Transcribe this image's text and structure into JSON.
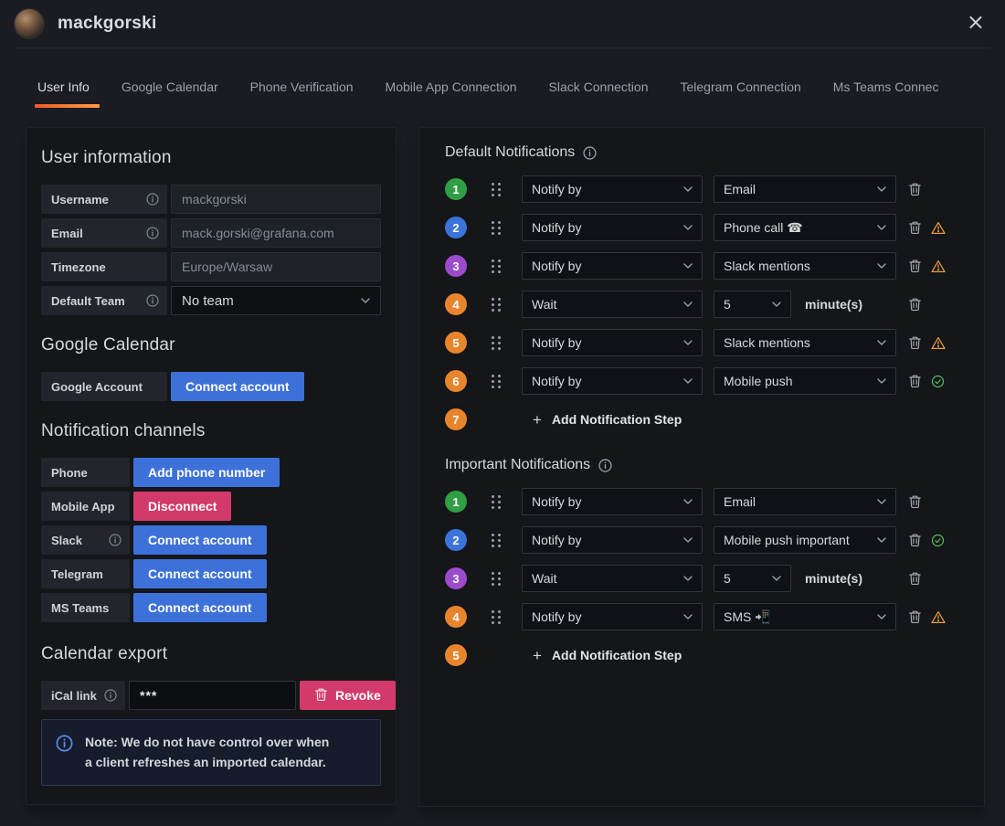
{
  "header": {
    "title": "mackgorski",
    "close_glyph": "×"
  },
  "tabs": [
    {
      "label": "User Info",
      "active": true
    },
    {
      "label": "Google Calendar",
      "active": false
    },
    {
      "label": "Phone Verification",
      "active": false
    },
    {
      "label": "Mobile App Connection",
      "active": false
    },
    {
      "label": "Slack Connection",
      "active": false
    },
    {
      "label": "Telegram Connection",
      "active": false
    },
    {
      "label": "Ms Teams Connec",
      "active": false
    }
  ],
  "user_info": {
    "heading": "User information",
    "fields": [
      {
        "label": "Username",
        "info": true,
        "value": "mackgorski",
        "control": "input"
      },
      {
        "label": "Email",
        "info": true,
        "value": "mack.gorski@grafana.com",
        "control": "input"
      },
      {
        "label": "Timezone",
        "info": false,
        "value": "Europe/Warsaw",
        "control": "input"
      },
      {
        "label": "Default Team",
        "info": true,
        "value": "No team",
        "control": "select"
      }
    ]
  },
  "google_calendar": {
    "heading": "Google Calendar",
    "label": "Google Account",
    "button_label": "Connect account"
  },
  "notification_channels": {
    "heading": "Notification channels",
    "rows": [
      {
        "label": "Phone",
        "info": false,
        "button_label": "Add phone number",
        "button_style": "primary"
      },
      {
        "label": "Mobile App",
        "info": false,
        "button_label": "Disconnect",
        "button_style": "danger"
      },
      {
        "label": "Slack",
        "info": true,
        "button_label": "Connect account",
        "button_style": "primary"
      },
      {
        "label": "Telegram",
        "info": false,
        "button_label": "Connect account",
        "button_style": "primary"
      },
      {
        "label": "MS Teams",
        "info": false,
        "button_label": "Connect account",
        "button_style": "primary"
      }
    ]
  },
  "calendar_export": {
    "heading": "Calendar export",
    "ical_label": "iCal link",
    "ical_value": "***",
    "revoke_label": "Revoke",
    "note": "Note: We do not have control over when a client refreshes an imported calendar."
  },
  "default_notifications": {
    "heading": "Default Notifications",
    "add_label": "Add Notification Step",
    "steps": [
      {
        "num": "1",
        "color": "green",
        "type": "notify",
        "select1": "Notify by",
        "select2": "Email",
        "icons": [
          "trash"
        ]
      },
      {
        "num": "2",
        "color": "blue",
        "type": "notify",
        "select1": "Notify by",
        "select2": "Phone call ☎",
        "icons": [
          "trash",
          "warning"
        ]
      },
      {
        "num": "3",
        "color": "purple",
        "type": "notify",
        "select1": "Notify by",
        "select2": "Slack mentions",
        "icons": [
          "trash",
          "warning"
        ]
      },
      {
        "num": "4",
        "color": "orange",
        "type": "wait",
        "select1": "Wait",
        "select2": "5",
        "suffix": "minute(s)",
        "icons": [
          "trash"
        ]
      },
      {
        "num": "5",
        "color": "orange",
        "type": "notify",
        "select1": "Notify by",
        "select2": "Slack mentions",
        "icons": [
          "trash",
          "warning"
        ]
      },
      {
        "num": "6",
        "color": "orange",
        "type": "notify",
        "select1": "Notify by",
        "select2": "Mobile push",
        "icons": [
          "trash",
          "check"
        ]
      },
      {
        "num": "7",
        "color": "orange",
        "type": "add"
      }
    ]
  },
  "important_notifications": {
    "heading": "Important Notifications",
    "add_label": "Add Notification Step",
    "steps": [
      {
        "num": "1",
        "color": "green",
        "type": "notify",
        "select1": "Notify by",
        "select2": "Email",
        "icons": [
          "trash"
        ]
      },
      {
        "num": "2",
        "color": "blue",
        "type": "notify",
        "select1": "Notify by",
        "select2": "Mobile push important",
        "icons": [
          "trash",
          "check"
        ]
      },
      {
        "num": "3",
        "color": "purple",
        "type": "wait",
        "select1": "Wait",
        "select2": "5",
        "suffix": "minute(s)",
        "icons": [
          "trash"
        ]
      },
      {
        "num": "4",
        "color": "orange",
        "type": "notify",
        "select1": "Notify by",
        "select2": "SMS 📲",
        "icons": [
          "trash",
          "warning"
        ]
      },
      {
        "num": "5",
        "color": "orange",
        "type": "add"
      }
    ]
  },
  "icons": {
    "plus": "+"
  },
  "colors": {
    "step_green": "#2f9e44",
    "step_blue": "#3b74d9",
    "step_purple": "#9c4bcc",
    "step_orange": "#e8852c",
    "primary_button": "#3d71d9",
    "danger_button": "#d23a6a",
    "warning": "#eda13e",
    "success": "#56bf63",
    "tab_underline_start": "#f05a28",
    "tab_underline_end": "#fb9d46"
  }
}
